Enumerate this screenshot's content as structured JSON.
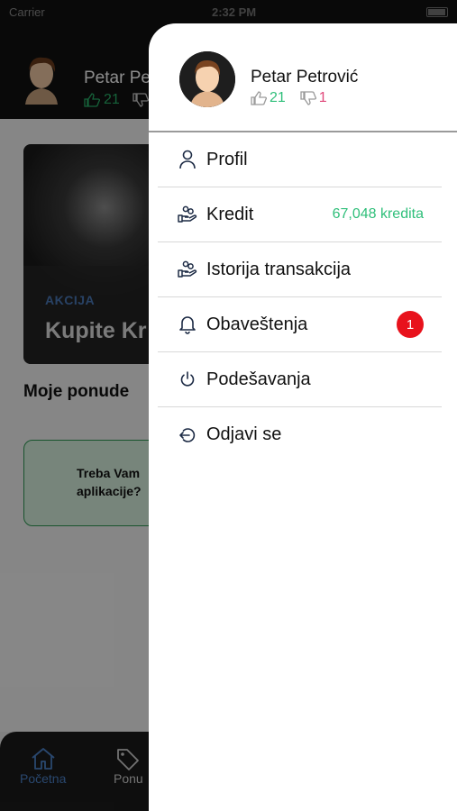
{
  "status_bar": {
    "carrier": "Carrier",
    "time": "2:32 PM"
  },
  "background": {
    "user_name": "Petar Pe",
    "likes": "21",
    "promo": {
      "tag": "AKCIJA",
      "title": "Kupite Kr"
    },
    "section_title": "Moje ponude",
    "help_text_line1": "Treba Vam",
    "help_text_line2": "aplikacije?",
    "tabs": [
      {
        "label": "Početna",
        "icon": "home-icon"
      },
      {
        "label": "Ponu",
        "icon": "tag-icon"
      }
    ]
  },
  "drawer": {
    "user": {
      "name": "Petar Petrović",
      "likes": "21",
      "dislikes": "1"
    },
    "menu": [
      {
        "label": "Profil",
        "icon": "user-icon"
      },
      {
        "label": "Kredit",
        "icon": "hand-coins-icon",
        "value": "67,048 kredita"
      },
      {
        "label": "Istorija transakcija",
        "icon": "hand-coins-icon"
      },
      {
        "label": "Obaveštenja",
        "icon": "bell-icon",
        "badge": "1"
      },
      {
        "label": "Podešavanja",
        "icon": "power-icon"
      },
      {
        "label": "Odjavi se",
        "icon": "logout-icon"
      }
    ]
  },
  "colors": {
    "accent_green": "#2fbf7a",
    "dislike_pink": "#e0487a",
    "badge_red": "#e8121c",
    "nav_blue": "#4b82c9"
  }
}
